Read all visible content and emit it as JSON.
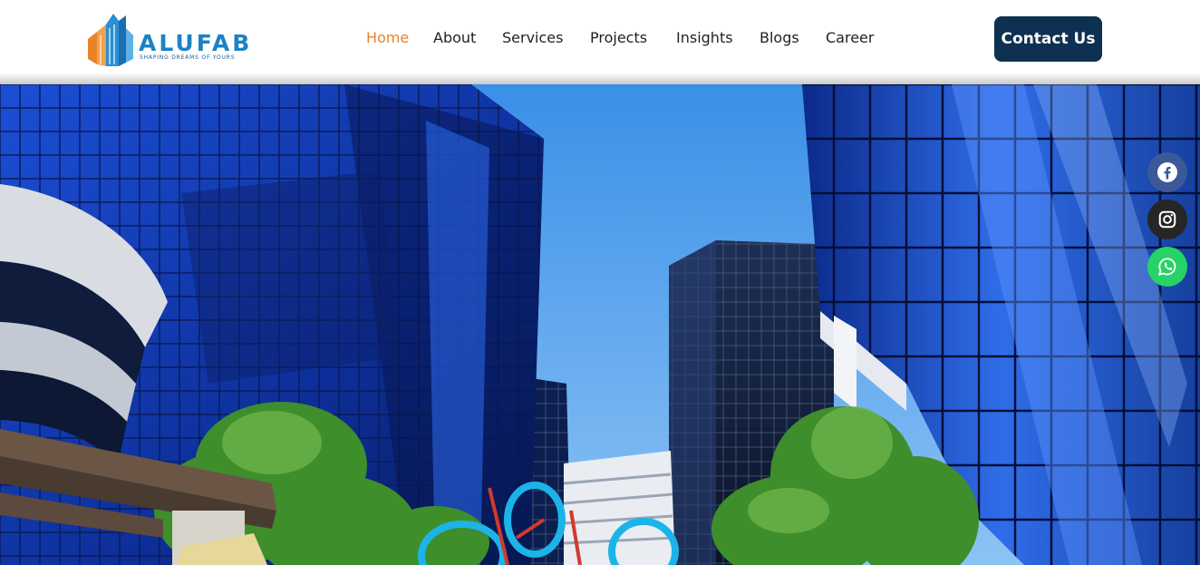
{
  "brand": {
    "name": "ALUFAB",
    "tagline": "SHAPING DREAMS OF YOURS",
    "colors": {
      "orange": "#e8832a",
      "blue": "#1b82c5",
      "navy": "#0f3151"
    }
  },
  "nav": {
    "items": [
      {
        "label": "Home",
        "active": true
      },
      {
        "label": "About",
        "active": false
      },
      {
        "label": "Services",
        "active": false
      },
      {
        "label": "Projects",
        "active": false
      },
      {
        "label": "Insights",
        "active": false
      },
      {
        "label": "Blogs",
        "active": false
      },
      {
        "label": "Career",
        "active": false
      }
    ]
  },
  "header": {
    "contact_label": "Contact Us"
  },
  "hero": {
    "image": "blue-glass-skyscrapers-photo"
  },
  "social": [
    {
      "name": "facebook-icon",
      "color": "#3b5998"
    },
    {
      "name": "instagram-icon",
      "color": "#262626"
    },
    {
      "name": "whatsapp-icon",
      "color": "#25d366"
    }
  ]
}
